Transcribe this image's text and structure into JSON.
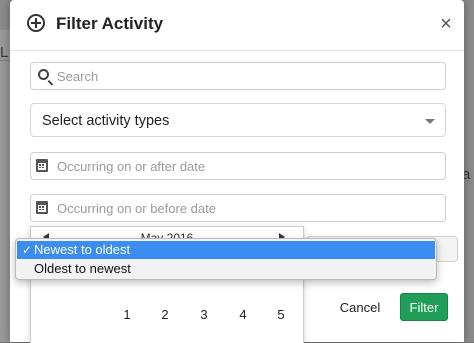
{
  "modal": {
    "title": "Filter Activity",
    "close_label": "×"
  },
  "search": {
    "placeholder": "Search"
  },
  "activity_select": {
    "label": "Select activity types"
  },
  "date_after": {
    "placeholder": "Occurring on or after date"
  },
  "date_before": {
    "placeholder": "Occurring on or before date"
  },
  "datepicker": {
    "month_label": "May 2016",
    "visible_days": [
      "1",
      "2",
      "3",
      "4",
      "5"
    ]
  },
  "sort_dropdown": {
    "options": [
      {
        "label": "Newest to oldest",
        "selected": true,
        "check": "✓"
      },
      {
        "label": "Oldest to newest",
        "selected": false
      }
    ]
  },
  "footer": {
    "cancel_label": "Cancel",
    "filter_label": "Filter"
  },
  "colors": {
    "primary": "#1f9e57",
    "selection": "#3b8ef0"
  },
  "icons": {
    "header": "plus-circle-icon",
    "search": "search-icon",
    "date": "calendar-icon"
  },
  "background_fragments": {
    "left": "L",
    "right": "a"
  }
}
